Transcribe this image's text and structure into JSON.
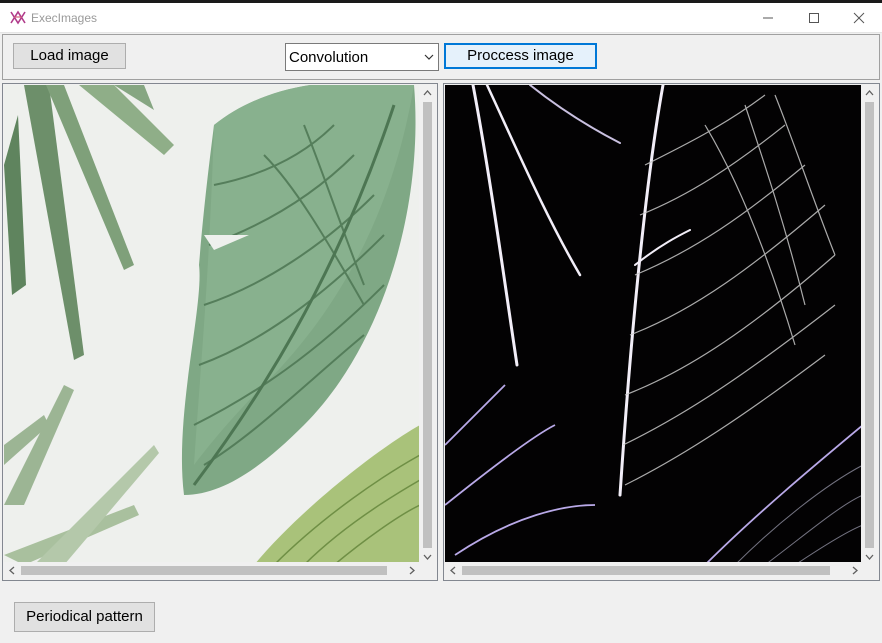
{
  "window": {
    "title": "ExecImages",
    "app_icon": "app-logo-icon",
    "controls": [
      "minimize-icon",
      "maximize-icon",
      "close-icon"
    ]
  },
  "toolbar": {
    "load_label": "Load image",
    "filter_select": {
      "selected": "Convolution"
    },
    "process_label": "Proccess image"
  },
  "panels": {
    "left": {
      "content": "original-image"
    },
    "right": {
      "content": "processed-image"
    }
  },
  "footer": {
    "periodical_label": "Periodical pattern"
  },
  "colors": {
    "accent": "#0078d7",
    "button_bg": "#e1e1e1",
    "window_bg": "#f0f0f0"
  }
}
